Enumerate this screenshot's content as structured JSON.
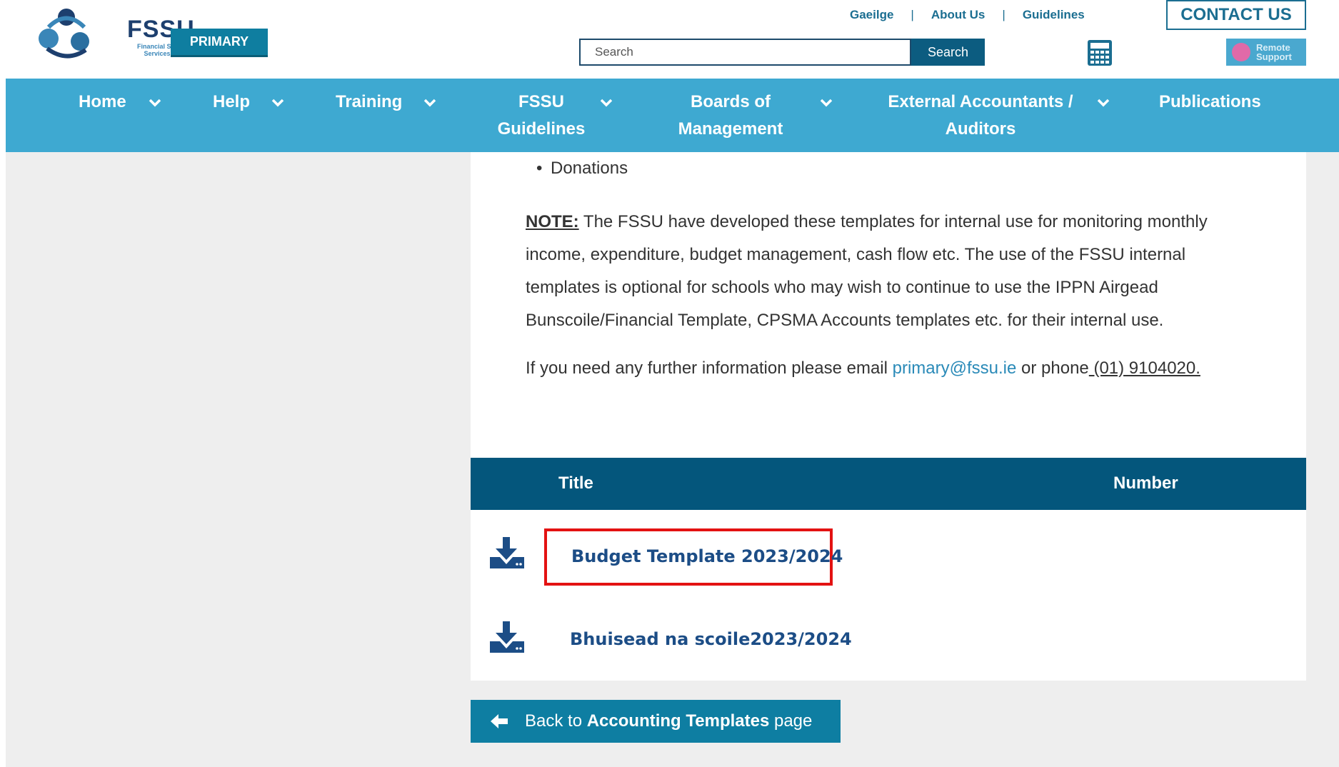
{
  "header": {
    "logo_text": "FSSU",
    "logo_subtext": "Financial Support Services Unit",
    "primary_label": "PRIMARY",
    "top_links": [
      "Gaeilge",
      "About Us",
      "Guidelines"
    ],
    "contact_label": "CONTACT US",
    "search_placeholder": "Search",
    "search_button": "Search",
    "remote_support_label": "Remote Support"
  },
  "nav": {
    "items": [
      {
        "label": "Home",
        "has_dropdown": true
      },
      {
        "label": "Help",
        "has_dropdown": true
      },
      {
        "label": "Training",
        "has_dropdown": true
      },
      {
        "label": "FSSU Guidelines",
        "has_dropdown": true
      },
      {
        "label": "Boards of Management",
        "has_dropdown": true
      },
      {
        "label": "External Accountants / Auditors",
        "has_dropdown": true
      },
      {
        "label": "Publications",
        "has_dropdown": false
      }
    ]
  },
  "content": {
    "bullet_item": "Donations",
    "note_label": "NOTE:",
    "note_text": " The FSSU have developed these templates for internal use for monitoring monthly income, expenditure, budget management, cash flow etc. The use of the FSSU internal templates is optional for schools who may wish to continue to use the IPPN Airgead Bunscoile/Financial Template, CPSMA Accounts templates etc. for their internal use.",
    "info_prefix": "If you need any further information please email ",
    "email": "primary@fssu.ie",
    "info_middle": " or phone",
    "phone": " (01) 9104020."
  },
  "table": {
    "headers": [
      "Title",
      "Number"
    ],
    "rows": [
      {
        "title": "Budget Template 2023/2024",
        "number": "",
        "highlighted": true
      },
      {
        "title": "Bhuisead na scoile2023/2024",
        "number": "",
        "highlighted": false
      }
    ]
  },
  "back_button": {
    "prefix": "Back to ",
    "bold": "Accounting Templates",
    "suffix": " page"
  },
  "colors": {
    "nav_bg": "#3ea9d1",
    "table_header_bg": "#04567c",
    "highlight_border": "#e31212",
    "link_blue": "#1c4d86"
  }
}
